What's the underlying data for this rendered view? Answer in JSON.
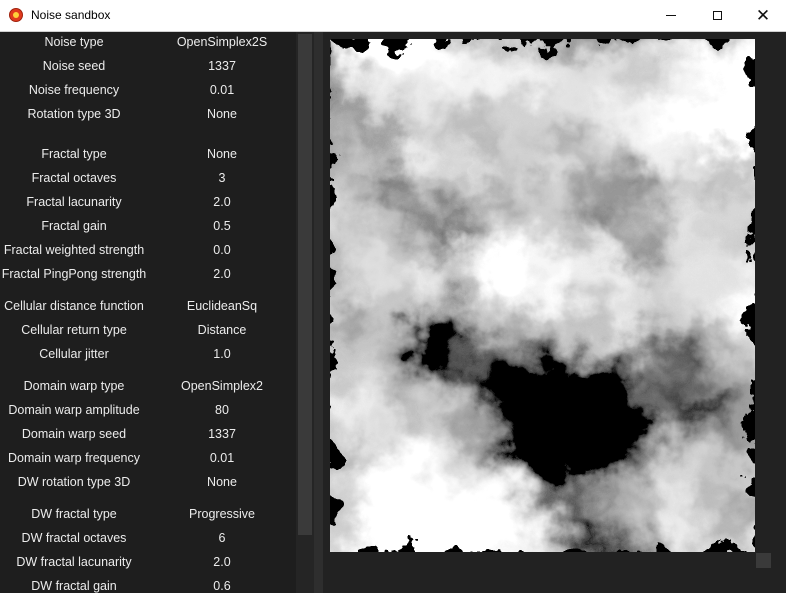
{
  "window": {
    "title": "Noise sandbox",
    "icon": "app-flame-icon",
    "minimize_icon": "minimize-icon",
    "maximize_icon": "maximize-icon",
    "close_icon": "close-icon"
  },
  "settings": [
    {
      "label": "Noise type",
      "value": "OpenSimplex2S"
    },
    {
      "label": "Noise seed",
      "value": "1337"
    },
    {
      "label": "Noise frequency",
      "value": "0.01"
    },
    {
      "label": "Rotation type 3D",
      "value": "None"
    },
    {
      "label": "Fractal type",
      "value": "None"
    },
    {
      "label": "Fractal octaves",
      "value": "3"
    },
    {
      "label": "Fractal lacunarity",
      "value": "2.0"
    },
    {
      "label": "Fractal gain",
      "value": "0.5"
    },
    {
      "label": "Fractal weighted strength",
      "value": "0.0"
    },
    {
      "label": "Fractal PingPong strength",
      "value": "2.0"
    },
    {
      "label": "Cellular distance function",
      "value": "EuclideanSq"
    },
    {
      "label": "Cellular return type",
      "value": "Distance"
    },
    {
      "label": "Cellular jitter",
      "value": "1.0"
    },
    {
      "label": "Domain warp type",
      "value": "OpenSimplex2"
    },
    {
      "label": "Domain warp amplitude",
      "value": "80"
    },
    {
      "label": "Domain warp seed",
      "value": "1337"
    },
    {
      "label": "Domain warp frequency",
      "value": "0.01"
    },
    {
      "label": "DW rotation type 3D",
      "value": "None"
    },
    {
      "label": "DW fractal type",
      "value": "Progressive"
    },
    {
      "label": "DW fractal octaves",
      "value": "6"
    },
    {
      "label": "DW fractal lacunarity",
      "value": "2.0"
    },
    {
      "label": "DW fractal gain",
      "value": "0.6"
    }
  ]
}
